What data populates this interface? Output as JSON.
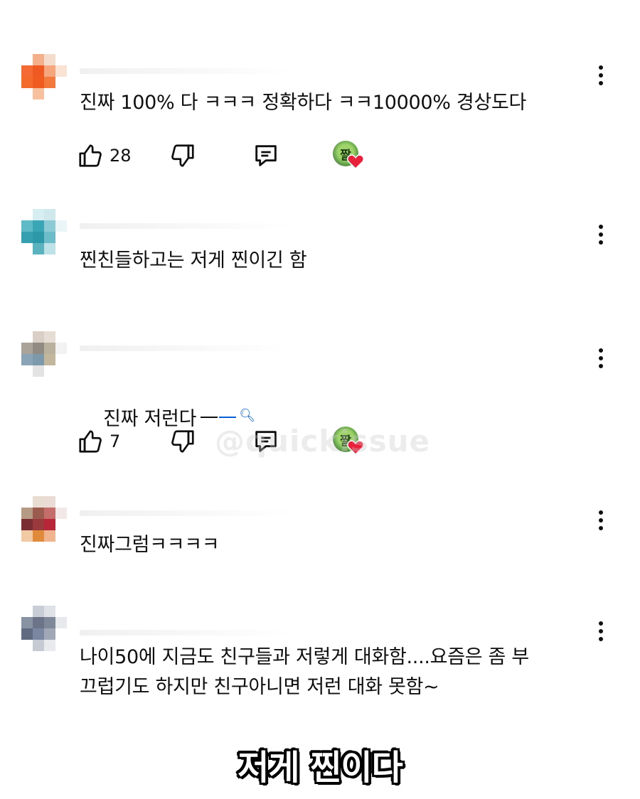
{
  "comments": [
    {
      "text": "진짜 100% 다 ㅋㅋㅋ 정확하다 ㅋㅋ10000% 경상도다",
      "likes": "28",
      "creator_heart_initial": "짤",
      "avatar_colors": [
        "#ffffff",
        "#f4b08a",
        "#f3dccb",
        "#ffffff",
        "#f46a32",
        "#ef5a23",
        "#f6a67c",
        "#fbe3d4",
        "#f36b2a",
        "#f05b20",
        "#f27a3d",
        "#ffffff",
        "#ffffff",
        "#f7c1a0",
        "#ffffff",
        "#ffffff"
      ]
    },
    {
      "text": "찐친들하고는 저게 찐이긴 함",
      "avatar_colors": [
        "#ffffff",
        "#d6eef1",
        "#cfe8ec",
        "#ffffff",
        "#5fbac7",
        "#3aa6b5",
        "#8ccbd5",
        "#e9f5f7",
        "#37a0b0",
        "#2c98a8",
        "#6cbdc9",
        "#ffffff",
        "#ffffff",
        "#5bb3c0",
        "#bfe2e8",
        "#ffffff"
      ]
    },
    {
      "text": "진짜 저런다",
      "likes": "7",
      "creator_heart_initial": "짤",
      "avatar_colors": [
        "#ffffff",
        "#d9cfc6",
        "#e6ddd5",
        "#ffffff",
        "#a9a39a",
        "#8f8a82",
        "#b9b19e",
        "#f2f2f2",
        "#8aa3b6",
        "#7d9aad",
        "#c2b79c",
        "#ffffff",
        "#ffffff",
        "#e3e3e3",
        "#ffffff",
        "#ffffff"
      ]
    },
    {
      "text": "진짜그럼ㅋㅋㅋㅋ",
      "avatar_colors": [
        "#ffffff",
        "#e8ddd0",
        "#eadbd5",
        "#ffffff",
        "#b59a84",
        "#9b5c4f",
        "#c46d6a",
        "#f3e8e8",
        "#7a2e34",
        "#9b3a3e",
        "#b8263a",
        "#ffffff",
        "#f1c9a3",
        "#e08a3b",
        "#f0b58f",
        "#ffffff"
      ]
    },
    {
      "text": "나이50에 지금도 친구들과 저렇게 대화함....요즘은 좀 부\n끄럽기도 하지만 친구아니면 저런 대화 못함~",
      "avatar_colors": [
        "#ffffff",
        "#c9ced6",
        "#dfe2e7",
        "#ffffff",
        "#8792a3",
        "#6b7488",
        "#7f8898",
        "#e7e9ed",
        "#606a81",
        "#7b86a0",
        "#a0a7b6",
        "#ffffff",
        "#ffffff",
        "#c6cad3",
        "#e9eaee",
        "#ffffff"
      ]
    }
  ],
  "watermark": "@quickissue",
  "caption": "저게 찐이다",
  "colors": {
    "text": "#0f0f0f",
    "link": "#065fd4",
    "heart": "#e8203a"
  }
}
